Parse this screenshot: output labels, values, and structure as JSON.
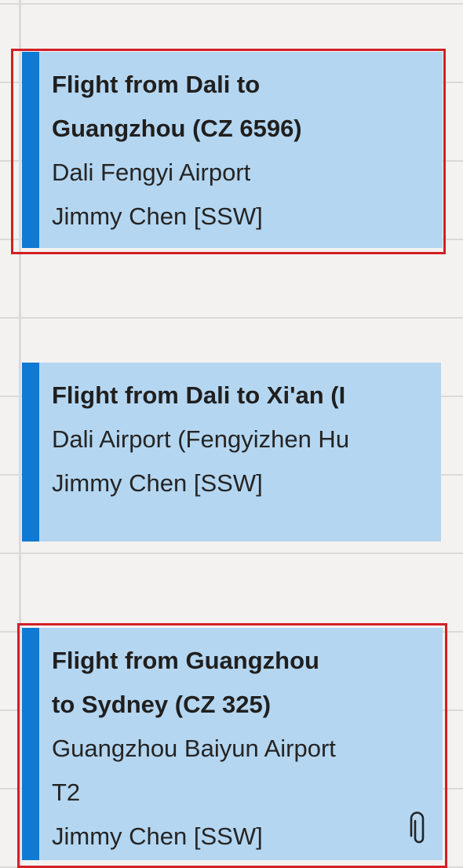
{
  "events": [
    {
      "title_lines": [
        "Flight from Dali to",
        "Guangzhou (CZ 6596)"
      ],
      "location_lines": [
        "Dali Fengyi Airport"
      ],
      "organizer": "Jimmy Chen [SSW]",
      "selected": true,
      "has_attachment": false
    },
    {
      "title_lines": [
        "Flight from Dali to Xi'an (I"
      ],
      "location_lines": [
        "Dali Airport (Fengyizhen Hu"
      ],
      "organizer": "Jimmy Chen [SSW]",
      "selected": false,
      "has_attachment": false
    },
    {
      "title_lines": [
        "Flight from Guangzhou",
        "to Sydney (CZ 325)"
      ],
      "location_lines": [
        "Guangzhou Baiyun Airport",
        "T2"
      ],
      "organizer": "Jimmy Chen [SSW]",
      "selected": true,
      "has_attachment": true,
      "attachment_icon": "paperclip-icon"
    }
  ],
  "colors": {
    "background": "#f3f2f1",
    "event_fill": "#b4d6f1",
    "event_accent": "#0f7ad3",
    "selection_outline": "#d51e25",
    "text": "#252423"
  }
}
